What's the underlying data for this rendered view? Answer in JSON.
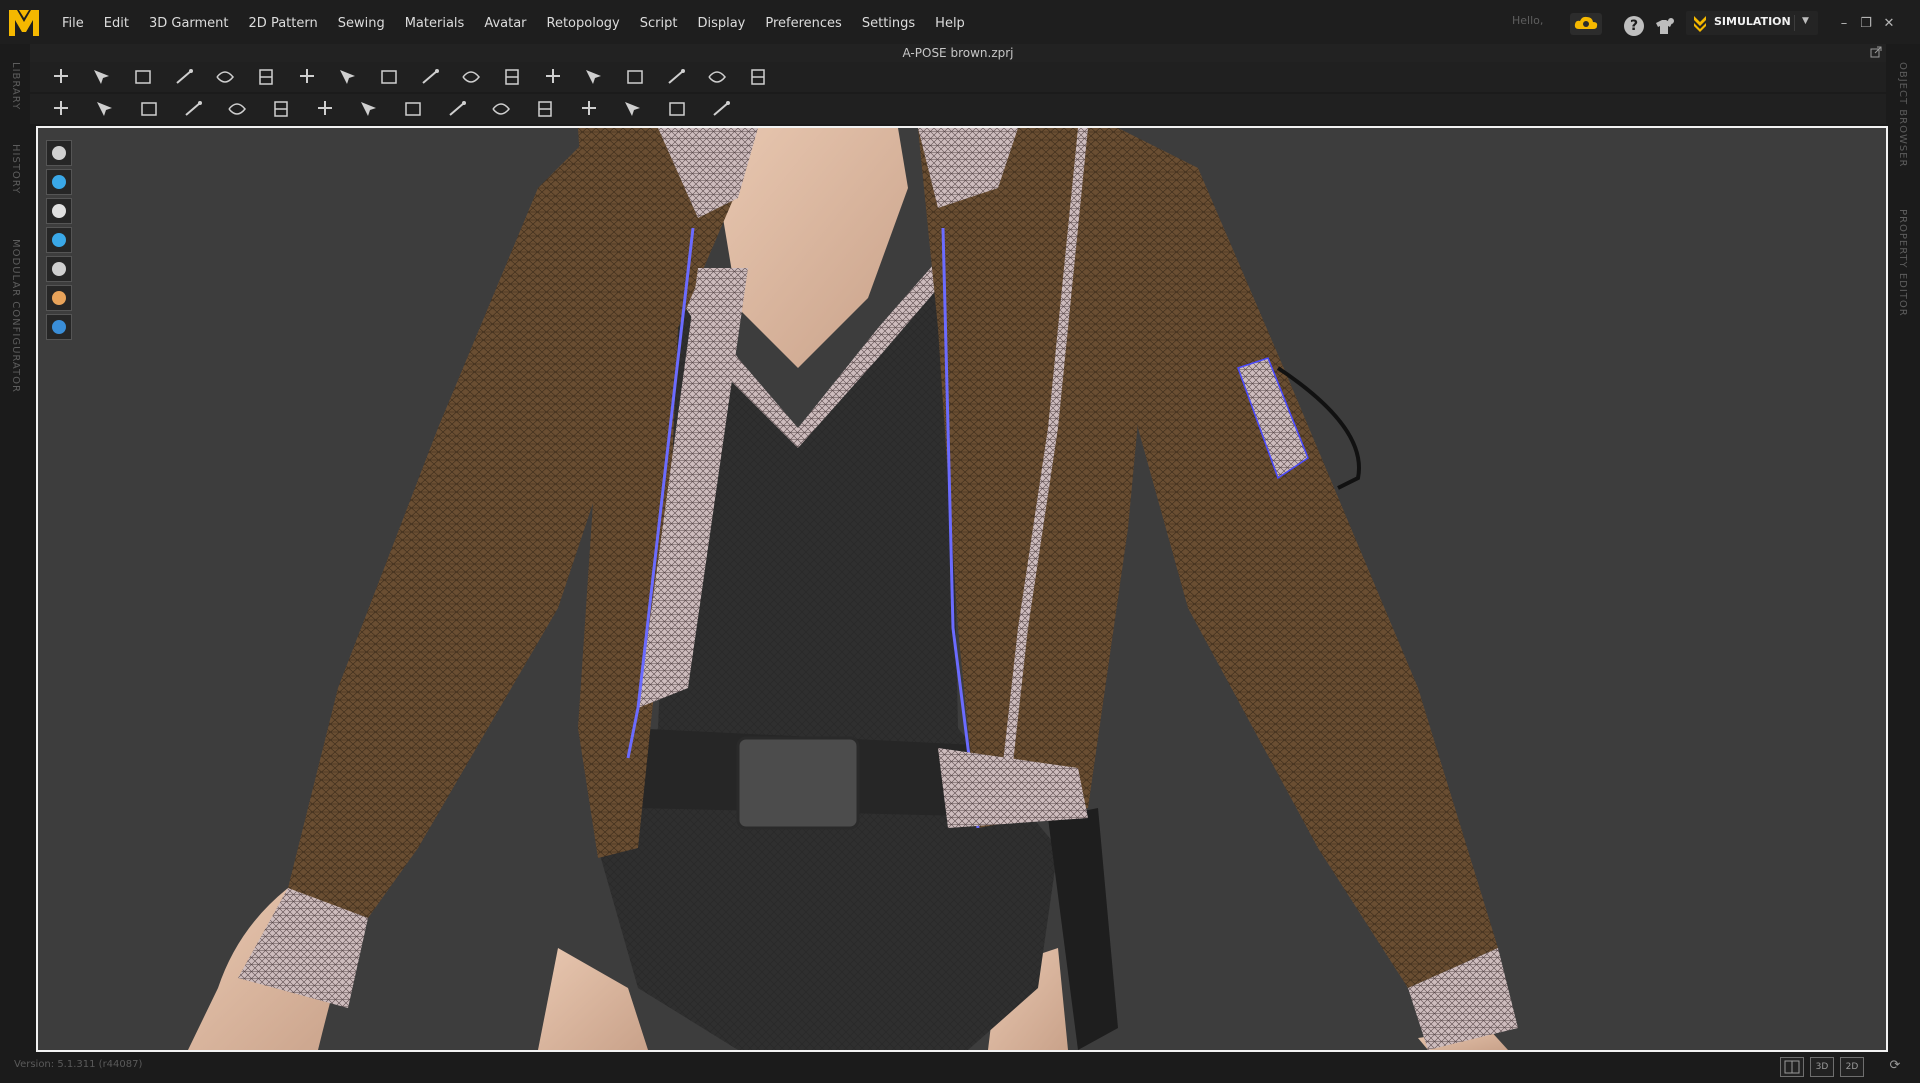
{
  "app": {
    "logo_icon": "marvelous-designer-logo-icon",
    "logo_color": "#f5b800",
    "menu": [
      "File",
      "Edit",
      "3D Garment",
      "2D Pattern",
      "Sewing",
      "Materials",
      "Avatar",
      "Retopology",
      "Script",
      "Display",
      "Preferences",
      "Settings",
      "Help"
    ],
    "greeting": "Hello,",
    "mode": "SIMULATION",
    "mode_accent": "#f5b800",
    "window_buttons": [
      "–",
      "❐",
      "✕"
    ]
  },
  "file": {
    "name": "A-POSE brown.zprj"
  },
  "side_panels": {
    "left": [
      "LIBRARY",
      "HISTORY",
      "MODULAR CONFIGURATOR"
    ],
    "right": [
      "OBJECT BROWSER",
      "PROPERTY EDITOR"
    ]
  },
  "toolbar_icons": {
    "row1": [
      "move-icon",
      "transform-pose-icon",
      "select-mesh-icon",
      "box-select-icon",
      "lasso-icon",
      "reset-2d-icon",
      "reset-3d-icon",
      "flip-icon",
      "tack-icon",
      "fold-icon",
      "strengthen-icon",
      "fold-arrange-icon",
      "pin-icon",
      "hanger-icon",
      "puckering-icon",
      "bottom-icon",
      "grid-icon",
      "mesh-grid-icon"
    ],
    "row2": [
      "avatar-pose-icon",
      "select-seam-icon",
      "zipper-icon",
      "stitch-icon",
      "steam-icon",
      "trim-icon",
      "button-icon",
      "buttonhole-icon",
      "measure-icon",
      "topstitch-icon",
      "tape-icon",
      "shrinkwrap-icon",
      "pin-avatar-icon",
      "weld-icon",
      "align-icon",
      "split-icon"
    ]
  },
  "scene_tools": [
    "garment-display-icon",
    "internal-line-icon",
    "avatar-display-icon",
    "texture-display-icon",
    "fabric-icon",
    "avatar-skin-icon",
    "environment-icon"
  ],
  "status": {
    "version": "Version: 5.1.311 (r44087)",
    "view_modes": [
      "",
      "3D",
      "2D"
    ]
  }
}
